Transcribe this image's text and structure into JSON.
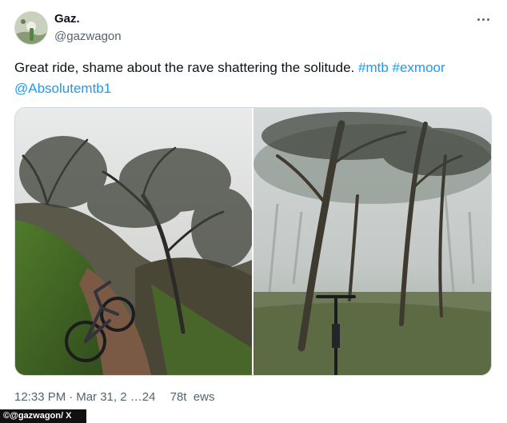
{
  "user": {
    "display_name": "Gaz.",
    "handle": "@gazwagon",
    "avatar_icon": "avatar-photo"
  },
  "menu": {
    "more_icon": "more-dots-icon"
  },
  "tweet": {
    "text_plain": "Great ride, shame about the rave shattering the solitude. ",
    "tags": [
      "#mtb",
      "#exmoor",
      "@Absolutemtb1"
    ]
  },
  "media": {
    "photos": [
      {
        "name": "photo-hillside-trail"
      },
      {
        "name": "photo-misty-forest"
      }
    ]
  },
  "meta": {
    "time": "12:33 PM",
    "separator": "·",
    "date": "Mar 31, 2 …24",
    "views": "78t  ews"
  },
  "source": {
    "credit": "©@gazwagon/ X"
  },
  "colors": {
    "link": "#1d9bf0",
    "secondary": "#536471",
    "text": "#0f1419"
  }
}
